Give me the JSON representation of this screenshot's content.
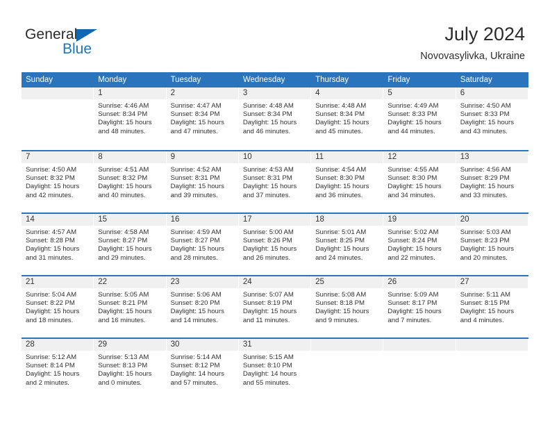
{
  "brand": {
    "name_top": "General",
    "name_bottom": "Blue",
    "accent_color": "#1b75bb",
    "triangle_color": "#1267b2"
  },
  "header": {
    "title": "July 2024",
    "subtitle": "Novovasylivka, Ukraine"
  },
  "calendar": {
    "header_bg": "#2a74bd",
    "header_text_color": "#ffffff",
    "day_band_bg": "#f0f0f0",
    "weekdays": [
      "Sunday",
      "Monday",
      "Tuesday",
      "Wednesday",
      "Thursday",
      "Friday",
      "Saturday"
    ],
    "weeks": [
      [
        {
          "day": ""
        },
        {
          "day": "1",
          "sunrise": "Sunrise: 4:46 AM",
          "sunset": "Sunset: 8:34 PM",
          "daylight": "Daylight: 15 hours and 48 minutes."
        },
        {
          "day": "2",
          "sunrise": "Sunrise: 4:47 AM",
          "sunset": "Sunset: 8:34 PM",
          "daylight": "Daylight: 15 hours and 47 minutes."
        },
        {
          "day": "3",
          "sunrise": "Sunrise: 4:48 AM",
          "sunset": "Sunset: 8:34 PM",
          "daylight": "Daylight: 15 hours and 46 minutes."
        },
        {
          "day": "4",
          "sunrise": "Sunrise: 4:48 AM",
          "sunset": "Sunset: 8:34 PM",
          "daylight": "Daylight: 15 hours and 45 minutes."
        },
        {
          "day": "5",
          "sunrise": "Sunrise: 4:49 AM",
          "sunset": "Sunset: 8:33 PM",
          "daylight": "Daylight: 15 hours and 44 minutes."
        },
        {
          "day": "6",
          "sunrise": "Sunrise: 4:50 AM",
          "sunset": "Sunset: 8:33 PM",
          "daylight": "Daylight: 15 hours and 43 minutes."
        }
      ],
      [
        {
          "day": "7",
          "sunrise": "Sunrise: 4:50 AM",
          "sunset": "Sunset: 8:32 PM",
          "daylight": "Daylight: 15 hours and 42 minutes."
        },
        {
          "day": "8",
          "sunrise": "Sunrise: 4:51 AM",
          "sunset": "Sunset: 8:32 PM",
          "daylight": "Daylight: 15 hours and 40 minutes."
        },
        {
          "day": "9",
          "sunrise": "Sunrise: 4:52 AM",
          "sunset": "Sunset: 8:31 PM",
          "daylight": "Daylight: 15 hours and 39 minutes."
        },
        {
          "day": "10",
          "sunrise": "Sunrise: 4:53 AM",
          "sunset": "Sunset: 8:31 PM",
          "daylight": "Daylight: 15 hours and 37 minutes."
        },
        {
          "day": "11",
          "sunrise": "Sunrise: 4:54 AM",
          "sunset": "Sunset: 8:30 PM",
          "daylight": "Daylight: 15 hours and 36 minutes."
        },
        {
          "day": "12",
          "sunrise": "Sunrise: 4:55 AM",
          "sunset": "Sunset: 8:30 PM",
          "daylight": "Daylight: 15 hours and 34 minutes."
        },
        {
          "day": "13",
          "sunrise": "Sunrise: 4:56 AM",
          "sunset": "Sunset: 8:29 PM",
          "daylight": "Daylight: 15 hours and 33 minutes."
        }
      ],
      [
        {
          "day": "14",
          "sunrise": "Sunrise: 4:57 AM",
          "sunset": "Sunset: 8:28 PM",
          "daylight": "Daylight: 15 hours and 31 minutes."
        },
        {
          "day": "15",
          "sunrise": "Sunrise: 4:58 AM",
          "sunset": "Sunset: 8:27 PM",
          "daylight": "Daylight: 15 hours and 29 minutes."
        },
        {
          "day": "16",
          "sunrise": "Sunrise: 4:59 AM",
          "sunset": "Sunset: 8:27 PM",
          "daylight": "Daylight: 15 hours and 28 minutes."
        },
        {
          "day": "17",
          "sunrise": "Sunrise: 5:00 AM",
          "sunset": "Sunset: 8:26 PM",
          "daylight": "Daylight: 15 hours and 26 minutes."
        },
        {
          "day": "18",
          "sunrise": "Sunrise: 5:01 AM",
          "sunset": "Sunset: 8:25 PM",
          "daylight": "Daylight: 15 hours and 24 minutes."
        },
        {
          "day": "19",
          "sunrise": "Sunrise: 5:02 AM",
          "sunset": "Sunset: 8:24 PM",
          "daylight": "Daylight: 15 hours and 22 minutes."
        },
        {
          "day": "20",
          "sunrise": "Sunrise: 5:03 AM",
          "sunset": "Sunset: 8:23 PM",
          "daylight": "Daylight: 15 hours and 20 minutes."
        }
      ],
      [
        {
          "day": "21",
          "sunrise": "Sunrise: 5:04 AM",
          "sunset": "Sunset: 8:22 PM",
          "daylight": "Daylight: 15 hours and 18 minutes."
        },
        {
          "day": "22",
          "sunrise": "Sunrise: 5:05 AM",
          "sunset": "Sunset: 8:21 PM",
          "daylight": "Daylight: 15 hours and 16 minutes."
        },
        {
          "day": "23",
          "sunrise": "Sunrise: 5:06 AM",
          "sunset": "Sunset: 8:20 PM",
          "daylight": "Daylight: 15 hours and 14 minutes."
        },
        {
          "day": "24",
          "sunrise": "Sunrise: 5:07 AM",
          "sunset": "Sunset: 8:19 PM",
          "daylight": "Daylight: 15 hours and 11 minutes."
        },
        {
          "day": "25",
          "sunrise": "Sunrise: 5:08 AM",
          "sunset": "Sunset: 8:18 PM",
          "daylight": "Daylight: 15 hours and 9 minutes."
        },
        {
          "day": "26",
          "sunrise": "Sunrise: 5:09 AM",
          "sunset": "Sunset: 8:17 PM",
          "daylight": "Daylight: 15 hours and 7 minutes."
        },
        {
          "day": "27",
          "sunrise": "Sunrise: 5:11 AM",
          "sunset": "Sunset: 8:15 PM",
          "daylight": "Daylight: 15 hours and 4 minutes."
        }
      ],
      [
        {
          "day": "28",
          "sunrise": "Sunrise: 5:12 AM",
          "sunset": "Sunset: 8:14 PM",
          "daylight": "Daylight: 15 hours and 2 minutes."
        },
        {
          "day": "29",
          "sunrise": "Sunrise: 5:13 AM",
          "sunset": "Sunset: 8:13 PM",
          "daylight": "Daylight: 15 hours and 0 minutes."
        },
        {
          "day": "30",
          "sunrise": "Sunrise: 5:14 AM",
          "sunset": "Sunset: 8:12 PM",
          "daylight": "Daylight: 14 hours and 57 minutes."
        },
        {
          "day": "31",
          "sunrise": "Sunrise: 5:15 AM",
          "sunset": "Sunset: 8:10 PM",
          "daylight": "Daylight: 14 hours and 55 minutes."
        },
        {
          "day": ""
        },
        {
          "day": ""
        },
        {
          "day": ""
        }
      ]
    ]
  }
}
